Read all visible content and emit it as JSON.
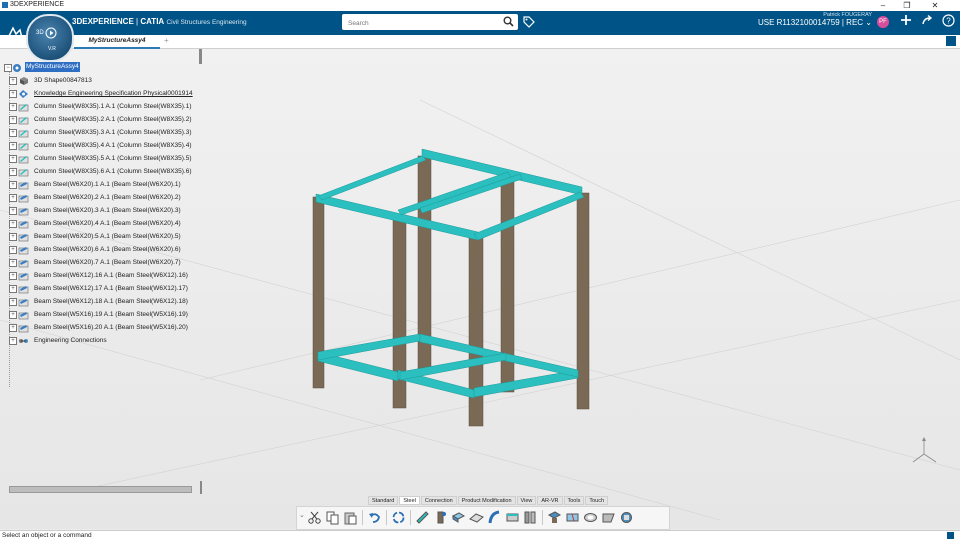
{
  "window": {
    "title": "3DEXPERIENCE"
  },
  "header": {
    "brand": "3DEXPERIENCE",
    "app": "CATIA",
    "app_sub": "Civil Structures Engineering",
    "compass_3d": "3D",
    "compass_version": "V.R",
    "search_placeholder": "Search",
    "user_name": "Patrick FOUGERAY",
    "user_id": "USE R1132100014759 | REC",
    "avatar_initials": "PF",
    "brand_color": "#005386"
  },
  "tabs": [
    {
      "label": "MyStructureAssy4"
    }
  ],
  "tree": {
    "root": "MyStructureAssy4",
    "items": [
      {
        "label": "3D Shape00847813",
        "icon": "shape-icon"
      },
      {
        "label": "Knowledge Engineering Specification Physical0001914",
        "icon": "knowledge-icon"
      },
      {
        "label": "Column Steel(W8X35).1 A.1 (Column Steel(W8X35).1)",
        "icon": "column-icon"
      },
      {
        "label": "Column Steel(W8X35).2 A.1 (Column Steel(W8X35).2)",
        "icon": "column-icon"
      },
      {
        "label": "Column Steel(W8X35).3 A.1 (Column Steel(W8X35).3)",
        "icon": "column-icon"
      },
      {
        "label": "Column Steel(W8X35).4 A.1 (Column Steel(W8X35).4)",
        "icon": "column-icon"
      },
      {
        "label": "Column Steel(W8X35).5 A.1 (Column Steel(W8X35).5)",
        "icon": "column-icon"
      },
      {
        "label": "Column Steel(W8X35).6 A.1 (Column Steel(W8X35).6)",
        "icon": "column-icon"
      },
      {
        "label": "Beam Steel(W6X20).1 A.1 (Beam Steel(W6X20).1)",
        "icon": "beam-icon"
      },
      {
        "label": "Beam Steel(W6X20).2 A.1 (Beam Steel(W6X20).2)",
        "icon": "beam-icon"
      },
      {
        "label": "Beam Steel(W6X20).3 A.1 (Beam Steel(W6X20).3)",
        "icon": "beam-icon"
      },
      {
        "label": "Beam Steel(W6X20).4 A.1 (Beam Steel(W6X20).4)",
        "icon": "beam-icon"
      },
      {
        "label": "Beam Steel(W6X20).5 A.1 (Beam Steel(W6X20).5)",
        "icon": "beam-icon"
      },
      {
        "label": "Beam Steel(W6X20).6 A.1 (Beam Steel(W6X20).6)",
        "icon": "beam-icon"
      },
      {
        "label": "Beam Steel(W6X20).7 A.1 (Beam Steel(W6X20).7)",
        "icon": "beam-icon"
      },
      {
        "label": "Beam Steel(W6X12).16 A.1 (Beam Steel(W6X12).16)",
        "icon": "beam-icon"
      },
      {
        "label": "Beam Steel(W6X12).17 A.1 (Beam Steel(W6X12).17)",
        "icon": "beam-icon"
      },
      {
        "label": "Beam Steel(W6X12).18 A.1 (Beam Steel(W6X12).18)",
        "icon": "beam-icon"
      },
      {
        "label": "Beam Steel(W5X16).19 A.1 (Beam Steel(W5X16).19)",
        "icon": "beam-icon"
      },
      {
        "label": "Beam Steel(W5X16).20 A.1 (Beam Steel(W5X16).20)",
        "icon": "beam-icon"
      },
      {
        "label": "Engineering Connections",
        "icon": "connections-icon"
      }
    ]
  },
  "toolbar": {
    "tabs": [
      "Standard",
      "Steel",
      "Connection",
      "Product Modification",
      "View",
      "AR-VR",
      "Tools",
      "Touch"
    ],
    "active_tab": "Steel"
  },
  "status": {
    "message": "Select an object or a command"
  },
  "model_colors": {
    "beam": "#2bbfbf",
    "column": "#7a6a55"
  }
}
